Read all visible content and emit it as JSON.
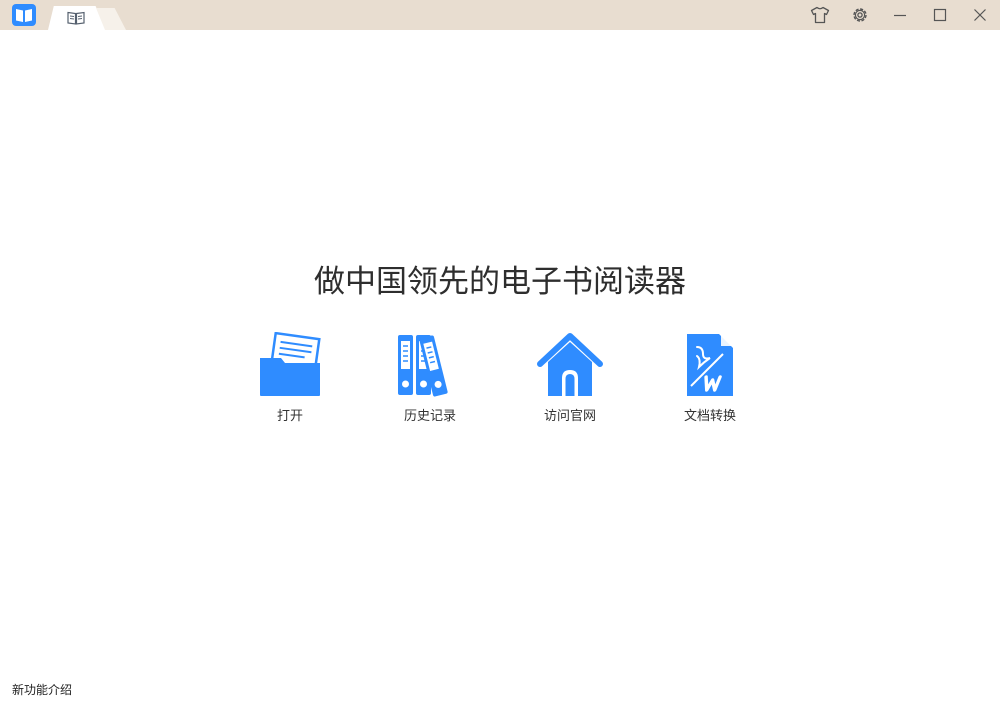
{
  "window": {
    "app_icon": "open-book-icon",
    "tab_icon": "book-icon",
    "controls": {
      "skin": "tshirt-icon",
      "settings": "gear-icon",
      "minimize": "minimize-icon",
      "maximize": "maximize-icon",
      "close": "close-icon"
    }
  },
  "main": {
    "headline": "做中国领先的电子书阅读器",
    "actions": [
      {
        "label": "打开",
        "icon": "folder-icon"
      },
      {
        "label": "历史记录",
        "icon": "binders-icon"
      },
      {
        "label": "访问官网",
        "icon": "house-icon"
      },
      {
        "label": "文档转换",
        "icon": "pdf-to-word-icon"
      }
    ]
  },
  "footer": {
    "new_features": "新功能介绍"
  },
  "colors": {
    "accent": "#2f8cff",
    "titlebar": "#e8ddd0",
    "text": "#2e2e2e"
  }
}
